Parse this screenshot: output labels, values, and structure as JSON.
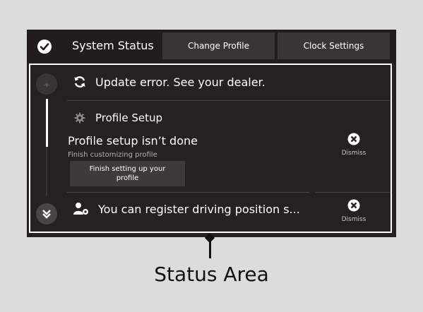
{
  "header": {
    "title": "System Status",
    "change_profile_label": "Change Profile",
    "clock_settings_label": "Clock Settings"
  },
  "notifications": {
    "update_error": "Update error. See your dealer.",
    "profile_setup_heading": "Profile Setup",
    "profile_setup_title": "Profile setup isn’t done",
    "profile_setup_subtitle": "Finish customizing profile",
    "finish_button_line1": "Finish setting up your",
    "finish_button_line2": "profile",
    "register_text": "You can register driving position s...",
    "dismiss_label": "Dismiss"
  },
  "annotation": {
    "caption": "Status Area"
  },
  "icons": {
    "header": "check-circle-icon",
    "update": "refresh-icon",
    "profile": "gear-icon",
    "register": "person-gear-icon",
    "dismiss": "close-circle-icon",
    "scroll_up": "chevron-up-icon",
    "scroll_down": "double-chevron-down-icon"
  },
  "colors": {
    "screen_bg": "#252120",
    "button_bg": "#3a3534",
    "text": "#ffffff",
    "outline": "#ffffff"
  }
}
